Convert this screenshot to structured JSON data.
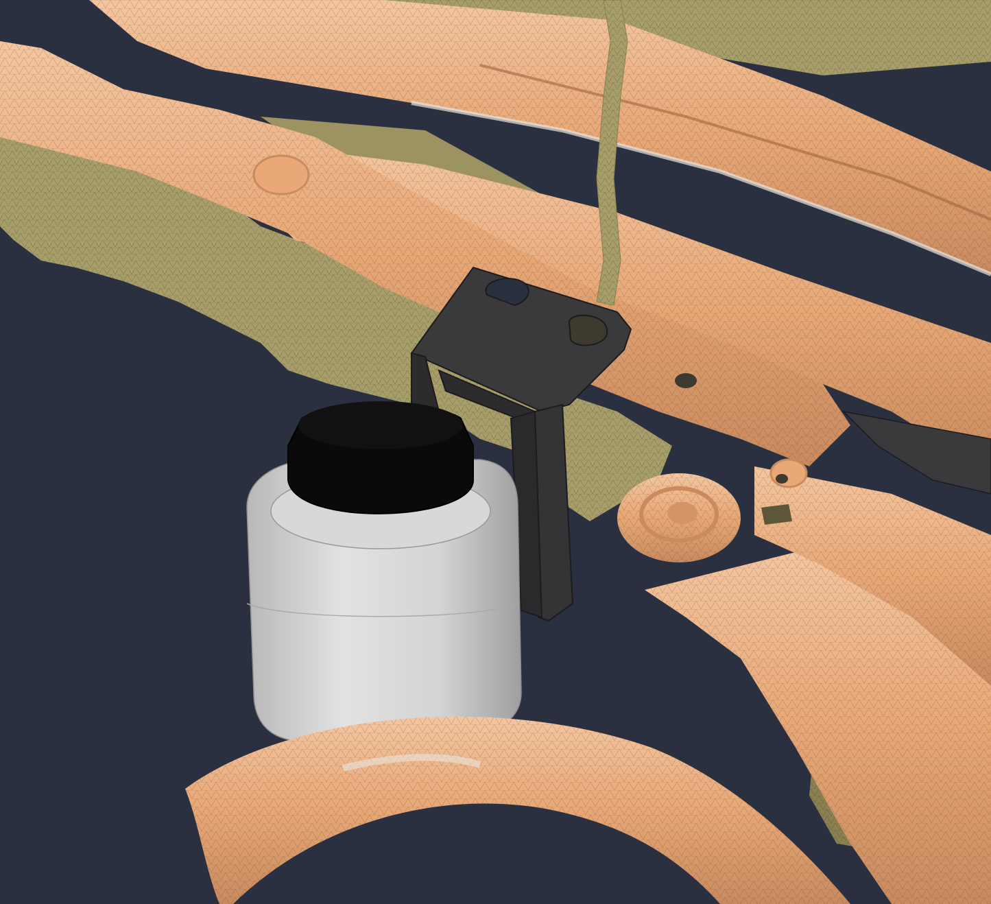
{
  "viewport": {
    "background_color": "#2a3040"
  },
  "scene": {
    "description_hidden": true,
    "colors": {
      "mesh_orange": "#e9a977",
      "mesh_orange_light": "#f3c19a",
      "mesh_orange_dark": "#c98a5e",
      "mesh_olive": "#a89e6a",
      "mesh_olive_dark": "#8a8052",
      "mesh_white": "#e8e6e0",
      "bracket_dark": "#3a3a3c",
      "bracket_edge": "#1c1c1e",
      "canister_body": "#d2d2d2",
      "canister_shadow": "#a9a9a9",
      "canister_cap": "#0a0a0a",
      "wire_line": "#5a4632"
    }
  }
}
